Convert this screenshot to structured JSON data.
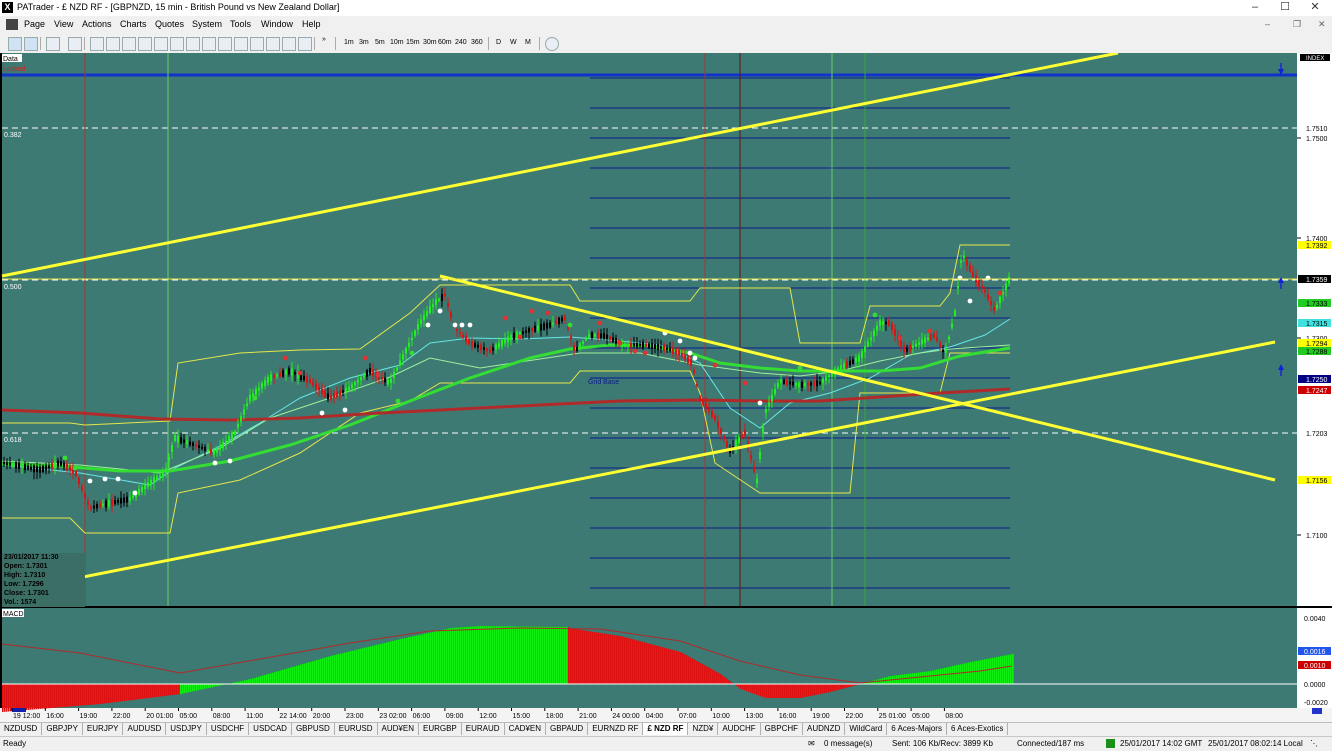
{
  "window": {
    "title": "PATrader - £ NZD RF - [GBPNZD, 15 min - British Pound vs New Zealand Dollar]",
    "controls": [
      "–",
      "☐",
      "✕"
    ]
  },
  "menu": {
    "items": [
      "Page",
      "View",
      "Actions",
      "Charts",
      "Quotes",
      "System",
      "Tools",
      "Window",
      "Help"
    ],
    "mdi_controls": [
      "–",
      "❐",
      "✕"
    ]
  },
  "toolbar": {
    "overflow": "»",
    "timeframes": [
      "1m",
      "3m",
      "5m",
      "10m",
      "15m",
      "30m",
      "60m",
      "240",
      "360"
    ],
    "periods": [
      "D",
      "W",
      "M"
    ]
  },
  "chart_panel": {
    "title": "Data",
    "locked_label": "Locked",
    "index_label": "INDEX",
    "grid_base_label": "Grid Base"
  },
  "fib_labels": [
    "0.382",
    "0.500",
    "0.618"
  ],
  "price_axis": {
    "plain": [
      "1.7500",
      "1.7400",
      "1.7300",
      "1.7100"
    ],
    "tags": [
      {
        "text": "1.7510",
        "bg": "#ffffff",
        "fg": "#000000"
      },
      {
        "text": "1.7392",
        "bg": "#ffff00",
        "fg": "#000000"
      },
      {
        "text": "1.7359",
        "bg": "#000000",
        "fg": "#ffffff"
      },
      {
        "text": "1.7333",
        "bg": "#22cc22",
        "fg": "#000000"
      },
      {
        "text": "1.7315",
        "bg": "#40e0e0",
        "fg": "#000000"
      },
      {
        "text": "1.7294",
        "bg": "#ffff00",
        "fg": "#000000"
      },
      {
        "text": "1.7288",
        "bg": "#22cc22",
        "fg": "#000000"
      },
      {
        "text": "1.7250",
        "bg": "#000080",
        "fg": "#ffffff"
      },
      {
        "text": "1.7247",
        "bg": "#cc0000",
        "fg": "#ffffff"
      },
      {
        "text": "1.7203",
        "bg": "#ffffff",
        "fg": "#000000"
      },
      {
        "text": "1.7156",
        "bg": "#ffff00",
        "fg": "#000000"
      }
    ]
  },
  "time_axis": [
    "19 12:00",
    "16:00",
    "19:00",
    "22:00",
    "20 01:00",
    "05:00",
    "08:00",
    "11:00",
    "22 14:00",
    "20:00",
    "23:00",
    "23 02:00",
    "06:00",
    "09:00",
    "12:00",
    "15:00",
    "18:00",
    "21:00",
    "24 00:00",
    "04:00",
    "07:00",
    "10:00",
    "13:00",
    "16:00",
    "19:00",
    "22:00",
    "25 01:00",
    "05:00",
    "08:00"
  ],
  "ohlc": {
    "date": "23/01/2017 11:30",
    "open": "Open: 1.7301",
    "high": "High: 1.7310",
    "low": "Low: 1.7296",
    "close": "Close: 1.7301",
    "vol": "Vol.: 1574"
  },
  "macd": {
    "label": "MACD",
    "axis": [
      "0.0040",
      "0.0020",
      "0.0000",
      "-0.0020"
    ],
    "tags": [
      {
        "text": "0.0016",
        "bg": "#2255ee",
        "fg": "#ffffff"
      },
      {
        "text": "0.0010",
        "bg": "#cc0000",
        "fg": "#ffffff"
      }
    ]
  },
  "tabs": [
    "NZDUSD",
    "GBPJPY",
    "EURJPY",
    "AUDUSD",
    "USDJPY",
    "USDCHF",
    "USDCAD",
    "GBPUSD",
    "EURUSD",
    "AUD¥EN",
    "EURGBP",
    "EURAUD",
    "CAD¥EN",
    "GBPAUD",
    "EURNZD RF",
    "£ NZD RF",
    "NZD¥",
    "AUDCHF",
    "GBPCHF",
    "AUDNZD",
    "WildCard",
    "6 Aces-Majors",
    "6 Aces-Exotics"
  ],
  "active_tab": "£ NZD RF",
  "status": {
    "ready": "Ready",
    "messages": "0 message(s)",
    "traffic": "Sent: 106 Kb/Recv: 3899 Kb",
    "connection": "Connected/187 ms",
    "gmt": "25/01/2017 14:02 GMT",
    "local": "25/01/2017 08:02:14 Local"
  },
  "colors": {
    "chart_bg": "#3d7a73",
    "ma_red": "#cc2222",
    "ma_green": "#33dd33",
    "trend_yellow": "#ffff33",
    "grid_blue": "#0c1a8c",
    "macd_green": "#11ee11",
    "macd_red": "#dd1111"
  }
}
